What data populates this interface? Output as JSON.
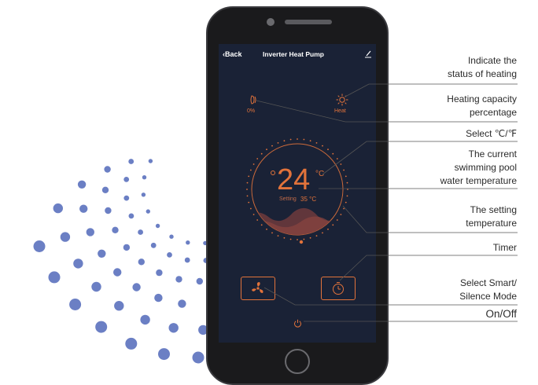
{
  "app": {
    "back_label": "Back",
    "title": "Inverter Heat Pump",
    "capacity_value": "0%",
    "heating_status": "Heat",
    "current_temp": "24",
    "temp_unit": "°C",
    "setting_label": "Setting",
    "setting_value": "35 °C"
  },
  "icons": {
    "back": "chevron-left-icon",
    "edit": "pencil-icon",
    "capacity": "capacity-icon",
    "status": "sun-icon",
    "mode": "fan-icon",
    "timer": "timer-icon",
    "power": "power-icon"
  },
  "annotations": [
    {
      "lines": [
        "Indicate the",
        "status of heating"
      ]
    },
    {
      "lines": [
        "Heating capacity",
        "percentage"
      ]
    },
    {
      "lines": [
        "Select ℃/℉"
      ]
    },
    {
      "lines": [
        "The current",
        "swimming pool",
        "water temperature"
      ]
    },
    {
      "lines": [
        "The setting",
        "temperature"
      ]
    },
    {
      "lines": [
        "Timer"
      ]
    },
    {
      "lines": [
        "Select Smart/",
        "Silence Mode"
      ]
    },
    {
      "lines": [
        "On/Off"
      ]
    }
  ],
  "colors": {
    "accent": "#e2733b",
    "screen_bg": "#1a2236",
    "dots": "#6b7fc4",
    "wave": "#6e3a3c"
  }
}
